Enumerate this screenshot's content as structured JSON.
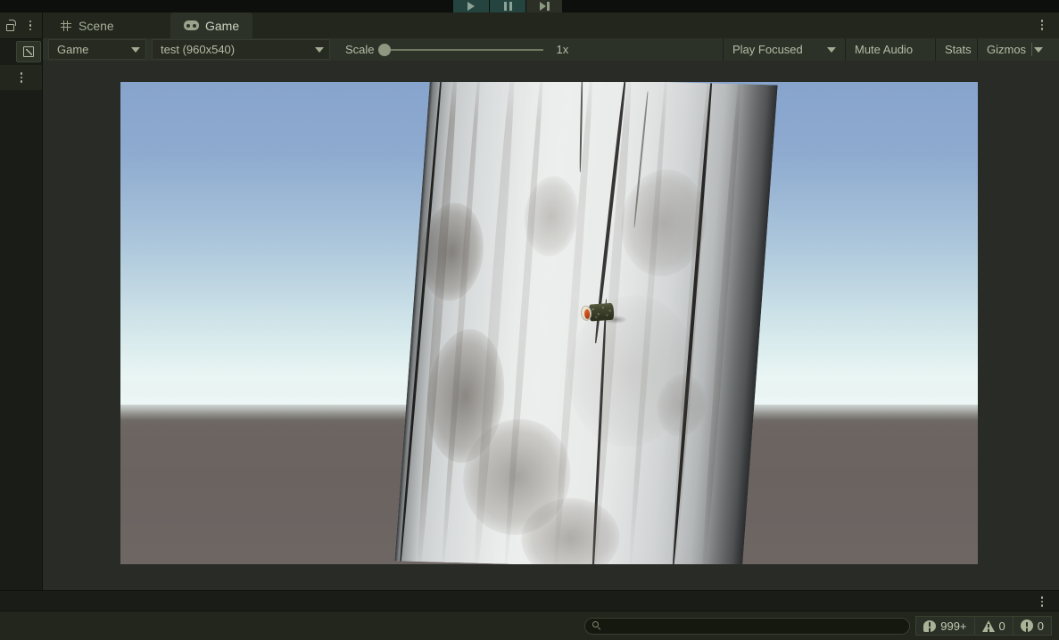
{
  "window": {
    "playback": {
      "play_label": "play-button",
      "pause_label": "pause-button",
      "step_label": "step-button"
    }
  },
  "left_rail": {
    "lock_icon": "lock-icon",
    "options_icon": "kebab-menu-icon",
    "maximize_icon": "maximize-icon"
  },
  "tabs": [
    {
      "label": "Scene",
      "icon": "grid-icon",
      "active": false
    },
    {
      "label": "Game",
      "icon": "gamepad-icon",
      "active": true
    }
  ],
  "game_toolbar": {
    "display_dropdown": "Game",
    "resolution_dropdown": "test (960x540)",
    "scale_label": "Scale",
    "scale_value": "1x",
    "scale_percent": 0,
    "play_mode_dropdown": "Play Focused",
    "mute_audio": "Mute Audio",
    "stats": "Stats",
    "gizmos": "Gizmos"
  },
  "game_view": {
    "scene_description": "weathered wooden pole with shotgun shell",
    "sky_top_color": "#87a4cd",
    "sky_horizon_color": "#eaf6f4",
    "ground_color": "#6b6360",
    "pole_color": "#e3e6e6",
    "shell_cap_color": "#c44a18",
    "shell_body_color": "#43462f"
  },
  "status_bar": {
    "search_placeholder": "",
    "search_value": "",
    "search_icon": "search-icon",
    "counters": [
      {
        "icon": "log-icon",
        "count": "999+"
      },
      {
        "icon": "warning-icon",
        "count": "0"
      },
      {
        "icon": "error-icon",
        "count": "0"
      }
    ]
  }
}
